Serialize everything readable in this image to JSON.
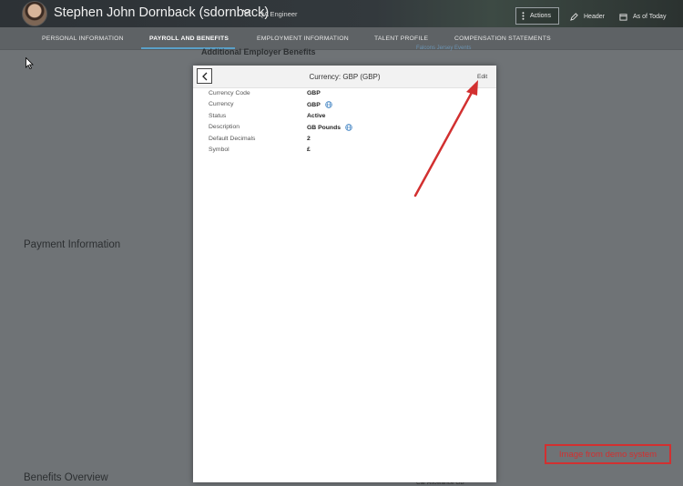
{
  "header": {
    "employee_name": "Stephen John Dornback (sdornback)",
    "role": "QA Engineer",
    "actions_label": "Actions",
    "header_label": "Header",
    "as_of_label": "As of Today"
  },
  "tabs": [
    {
      "label": "PERSONAL INFORMATION",
      "active": false
    },
    {
      "label": "PAYROLL AND BENEFITS",
      "active": true
    },
    {
      "label": "EMPLOYMENT INFORMATION",
      "active": false
    },
    {
      "label": "TALENT PROFILE",
      "active": false
    },
    {
      "label": "COMPENSATION STATEMENTS",
      "active": false
    }
  ],
  "background": {
    "section_additional": "Additional Employer Benefits",
    "link_top": "Falcons Jersey Events",
    "section_payment": "Payment Information",
    "section_benefits": "Benefits Overview",
    "small_bottom": "Car Allowance GB"
  },
  "dialog": {
    "title": "Currency: GBP (GBP)",
    "edit_label": "Edit",
    "fields": [
      {
        "label": "Currency Code",
        "value": "GBP",
        "globe": false
      },
      {
        "label": "Currency",
        "value": "GBP",
        "globe": true
      },
      {
        "label": "Status",
        "value": "Active",
        "globe": false
      },
      {
        "label": "Description",
        "value": "GB Pounds",
        "globe": true
      },
      {
        "label": "Default Decimals",
        "value": "2",
        "globe": false
      },
      {
        "label": "Symbol",
        "value": "£",
        "globe": false
      }
    ]
  },
  "annotation": {
    "watermark": "Image from demo system",
    "color": "#d23030"
  },
  "icons": {
    "back": "chevron-left-icon",
    "globe": "globe-icon",
    "header": "pencil-icon",
    "as_of": "calendar-icon",
    "actions": "vertical-ellipsis-icon",
    "name_menu": "chevron-down-icon"
  }
}
